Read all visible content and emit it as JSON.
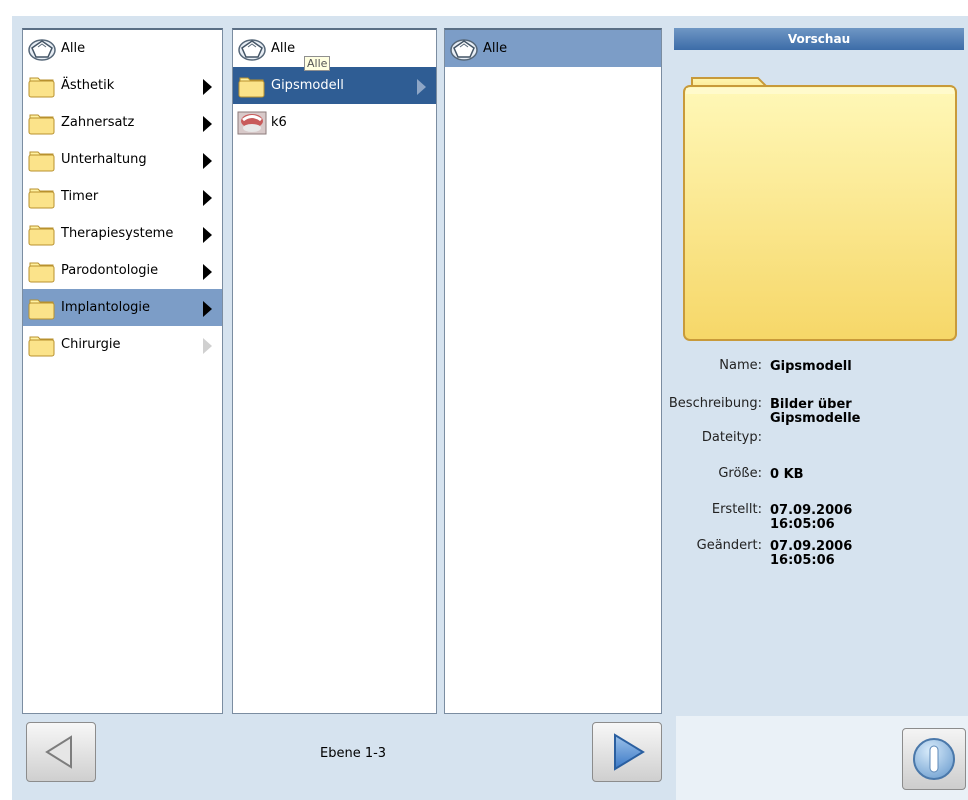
{
  "columns": {
    "level1": [
      {
        "label": "Alle",
        "icon": "all-icon",
        "arrow": "none",
        "selected": false
      },
      {
        "label": "Ästhetik",
        "icon": "folder-icon",
        "arrow": "black",
        "selected": false
      },
      {
        "label": "Zahnersatz",
        "icon": "folder-icon",
        "arrow": "black",
        "selected": false
      },
      {
        "label": "Unterhaltung",
        "icon": "folder-icon",
        "arrow": "black",
        "selected": false
      },
      {
        "label": "Timer",
        "icon": "folder-icon",
        "arrow": "black",
        "selected": false
      },
      {
        "label": "Therapiesysteme",
        "icon": "folder-icon",
        "arrow": "black",
        "selected": false
      },
      {
        "label": "Parodontologie",
        "icon": "folder-icon",
        "arrow": "black",
        "selected": false
      },
      {
        "label": "Implantologie",
        "icon": "folder-icon",
        "arrow": "black",
        "selected": true
      },
      {
        "label": "Chirurgie",
        "icon": "folder-icon",
        "arrow": "grey",
        "selected": false
      }
    ],
    "level2": [
      {
        "label": "Alle",
        "icon": "all-icon",
        "arrow": "none",
        "selected": false
      },
      {
        "label": "Gipsmodell",
        "icon": "folder-icon",
        "arrow": "light",
        "selected": true
      },
      {
        "label": "k6",
        "icon": "image-thumbnail-icon",
        "arrow": "none",
        "selected": false
      }
    ],
    "level3": [
      {
        "label": "Alle",
        "icon": "all-icon",
        "arrow": "none",
        "selected": true
      }
    ]
  },
  "tooltip": "Alle",
  "preview": {
    "title": "Vorschau",
    "fields": {
      "name_label": "Name:",
      "name_value": "Gipsmodell",
      "description_label": "Beschreibung:",
      "description_value": "Bilder über\nGipsmodelle",
      "filetype_label": "Dateityp:",
      "filetype_value": "",
      "size_label": "Größe:",
      "size_value": "0 KB",
      "created_label": "Erstellt:",
      "created_value": "07.09.2006\n16:05:06",
      "modified_label": "Geändert:",
      "modified_value": "07.09.2006\n16:05:06"
    }
  },
  "footer": {
    "level_label": "Ebene 1-3"
  },
  "colors": {
    "panel": "#d6e3ef",
    "selection_light": "#7c9dc7",
    "selection_dark": "#2f5d94",
    "header_blue": "#3c6ca8"
  }
}
